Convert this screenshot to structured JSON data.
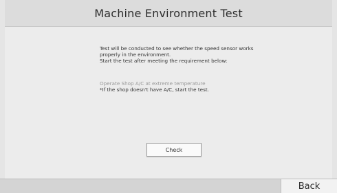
{
  "header": {
    "title": "Machine Environment Test"
  },
  "main": {
    "description_lines": [
      "Test will be conducted to see whether the speed sensor works",
      "properly in the environment.",
      "Start the test after meeting the requirement below:"
    ],
    "requirement_label": "Operate Shop A/C at extreme temperature",
    "requirement_note": "*If the shop doesn't have A/C, start the test.",
    "check_label": "Check"
  },
  "footer": {
    "back_label": "Back"
  },
  "colors": {
    "background": "#ececec",
    "header_background": "#dcdcdc",
    "footer_background": "#d4d4d4",
    "muted_text": "#9a9a9a"
  }
}
